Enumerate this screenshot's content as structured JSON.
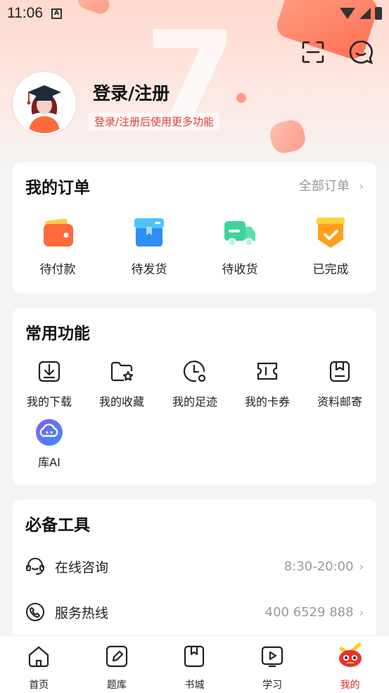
{
  "status_bar": {
    "time": "11:06"
  },
  "profile": {
    "title": "登录/注册",
    "subtitle": "登录/注册后使用更多功能"
  },
  "header_icons": [
    "scan-icon",
    "message-icon"
  ],
  "orders": {
    "title": "我的订单",
    "all_label": "全部订单",
    "items": [
      {
        "label": "待付款",
        "icon": "wallet-icon"
      },
      {
        "label": "待发货",
        "icon": "package-icon"
      },
      {
        "label": "待收货",
        "icon": "truck-icon"
      },
      {
        "label": "已完成",
        "icon": "completed-icon"
      }
    ]
  },
  "functions": {
    "title": "常用功能",
    "items": [
      {
        "label": "我的下载",
        "icon": "download-icon"
      },
      {
        "label": "我的收藏",
        "icon": "favorite-folder-icon"
      },
      {
        "label": "我的足迹",
        "icon": "history-clock-icon"
      },
      {
        "label": "我的卡券",
        "icon": "coupon-icon"
      },
      {
        "label": "资料邮寄",
        "icon": "mail-box-icon"
      },
      {
        "label": "库AI",
        "icon": "ai-bot-icon"
      }
    ]
  },
  "tools": {
    "title": "必备工具",
    "items": [
      {
        "label": "在线咨询",
        "value": "8:30-20:00",
        "icon": "headset-icon"
      },
      {
        "label": "服务热线",
        "value": "400 6529 888",
        "icon": "phone-icon"
      }
    ]
  },
  "bottom_nav": {
    "items": [
      {
        "label": "首页",
        "icon": "home-icon"
      },
      {
        "label": "题库",
        "icon": "edit-icon"
      },
      {
        "label": "书城",
        "icon": "bookmark-book-icon"
      },
      {
        "label": "学习",
        "icon": "play-book-icon"
      },
      {
        "label": "我的",
        "icon": "mascot-icon"
      }
    ],
    "active": "我的"
  },
  "colors": {
    "accent": "#e32b2b",
    "hero_bg": "#ffd9cf"
  }
}
